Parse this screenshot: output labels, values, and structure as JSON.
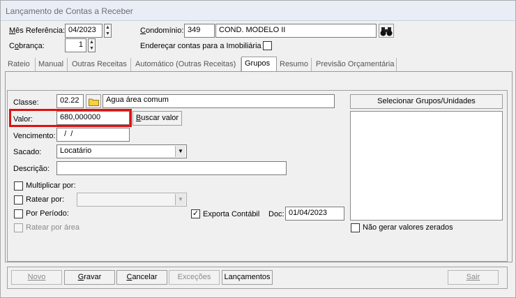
{
  "window": {
    "title": "Lançamento de Contas a Receber"
  },
  "header": {
    "mes_referencia_label": "Mês Referência:",
    "mes_referencia_value": "04/2023",
    "condominio_label": "Condomínio:",
    "condominio_code": "349",
    "condominio_name": "COND. MODELO II",
    "cobranca_label": "Cobrança:",
    "cobranca_value": "1",
    "enderecar_label": "Endereçar contas para a Imobiliária"
  },
  "tabs": [
    "Rateio",
    "Manual",
    "Outras Receitas",
    "Automático (Outras Receitas)",
    "Grupos",
    "Resumo",
    "Previsão Orçamentária"
  ],
  "form": {
    "classe_label": "Classe:",
    "classe_code": "02.22",
    "classe_desc": "Agua área comum",
    "valor_label": "Valor:",
    "valor_value": "680,000000",
    "buscar_valor": "Buscar valor",
    "vencimento_label": "Vencimento:",
    "vencimento_value": "  /  /",
    "sacado_label": "Sacado:",
    "sacado_value": "Locatário",
    "descricao_label": "Descrição:",
    "descricao_value": "",
    "multiplicar_label": "Multiplicar por:",
    "ratear_label": "Ratear por:",
    "por_periodo_label": "Por Período:",
    "ratear_area_label": "Ratear por área",
    "exporta_contabil_label": "Exporta Contábil",
    "doc_label": "Doc:",
    "doc_value": "01/04/2023",
    "selecionar_grupos": "Selecionar Grupos/Unidades",
    "nao_gerar_label": "Não gerar valores zerados"
  },
  "footer": {
    "novo": "Novo",
    "gravar": "Gravar",
    "cancelar": "Cancelar",
    "excecoes": "Exceções",
    "lancamentos": "Lançamentos",
    "sair": "Sair"
  },
  "colors": {
    "highlight": "#e01010",
    "folder": "#f5d040"
  },
  "icons": {
    "search": "binoculars-icon",
    "folder": "folder-icon"
  }
}
